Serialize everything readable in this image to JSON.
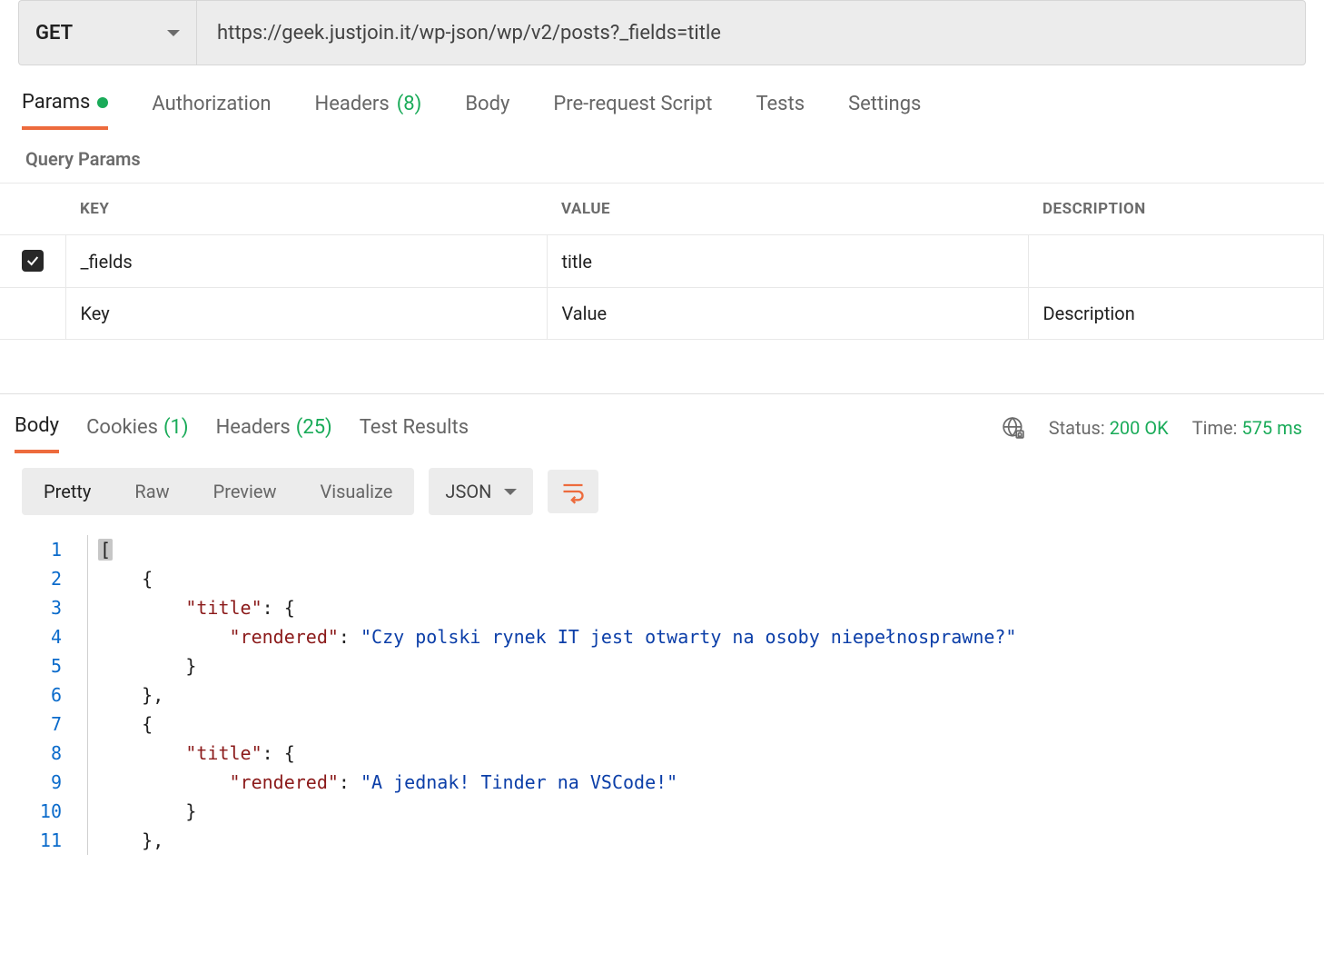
{
  "request": {
    "method": "GET",
    "url": "https://geek.justjoin.it/wp-json/wp/v2/posts?_fields=title"
  },
  "request_tabs": {
    "params": "Params",
    "authorization": "Authorization",
    "headers_label": "Headers",
    "headers_count": "(8)",
    "body": "Body",
    "prerequest": "Pre-request Script",
    "tests": "Tests",
    "settings": "Settings"
  },
  "params_section": {
    "title": "Query Params",
    "columns": {
      "key": "KEY",
      "value": "VALUE",
      "description": "DESCRIPTION"
    },
    "rows": [
      {
        "checked": true,
        "key": "_fields",
        "value": "title",
        "description": ""
      }
    ],
    "placeholders": {
      "key": "Key",
      "value": "Value",
      "description": "Description"
    }
  },
  "response_tabs": {
    "body": "Body",
    "cookies_label": "Cookies",
    "cookies_count": "(1)",
    "headers_label": "Headers",
    "headers_count": "(25)",
    "test_results": "Test Results"
  },
  "response_meta": {
    "status_label": "Status:",
    "status_value": "200 OK",
    "time_label": "Time:",
    "time_value": "575 ms"
  },
  "body_toolbar": {
    "pretty": "Pretty",
    "raw": "Raw",
    "preview": "Preview",
    "visualize": "Visualize",
    "format": "JSON"
  },
  "response_body": [
    {
      "n": 1,
      "indent": 0,
      "tokens": [
        {
          "t": "bracket",
          "v": "["
        }
      ]
    },
    {
      "n": 2,
      "indent": 1,
      "tokens": [
        {
          "t": "punct",
          "v": "{"
        }
      ]
    },
    {
      "n": 3,
      "indent": 2,
      "tokens": [
        {
          "t": "key",
          "v": "\"title\""
        },
        {
          "t": "punct",
          "v": ": {"
        }
      ]
    },
    {
      "n": 4,
      "indent": 3,
      "tokens": [
        {
          "t": "key",
          "v": "\"rendered\""
        },
        {
          "t": "punct",
          "v": ": "
        },
        {
          "t": "str",
          "v": "\"Czy polski rynek IT jest otwarty na osoby niepełnosprawne?\""
        }
      ]
    },
    {
      "n": 5,
      "indent": 2,
      "tokens": [
        {
          "t": "punct",
          "v": "}"
        }
      ]
    },
    {
      "n": 6,
      "indent": 1,
      "tokens": [
        {
          "t": "punct",
          "v": "},"
        }
      ]
    },
    {
      "n": 7,
      "indent": 1,
      "tokens": [
        {
          "t": "punct",
          "v": "{"
        }
      ]
    },
    {
      "n": 8,
      "indent": 2,
      "tokens": [
        {
          "t": "key",
          "v": "\"title\""
        },
        {
          "t": "punct",
          "v": ": {"
        }
      ]
    },
    {
      "n": 9,
      "indent": 3,
      "tokens": [
        {
          "t": "key",
          "v": "\"rendered\""
        },
        {
          "t": "punct",
          "v": ": "
        },
        {
          "t": "str",
          "v": "\"A jednak! Tinder na VSCode!\""
        }
      ]
    },
    {
      "n": 10,
      "indent": 2,
      "tokens": [
        {
          "t": "punct",
          "v": "}"
        }
      ]
    },
    {
      "n": 11,
      "indent": 1,
      "tokens": [
        {
          "t": "punct",
          "v": "},"
        }
      ]
    }
  ]
}
